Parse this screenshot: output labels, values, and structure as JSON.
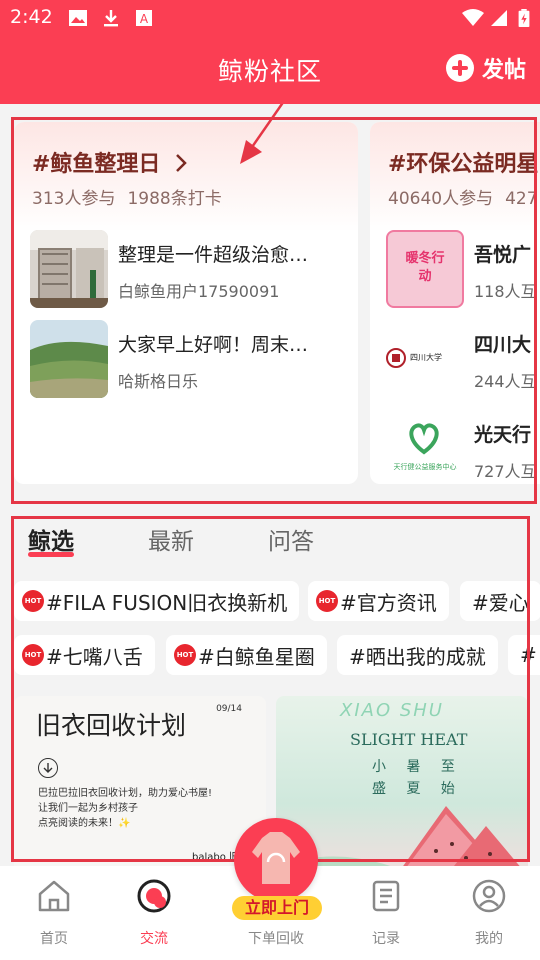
{
  "status_bar": {
    "time": "2:42"
  },
  "header": {
    "title": "鲸粉社区",
    "post_label": "发帖"
  },
  "topics": [
    {
      "title": "#鲸鱼整理日",
      "participants": "313人参与",
      "checkins": "1988条打卡",
      "items": [
        {
          "title": "整理是一件超级治愈…",
          "user": "白鲸鱼用户17590091"
        },
        {
          "title": "大家早上好啊！周末…",
          "user": "哈斯格日乐"
        }
      ]
    },
    {
      "title": "#环保公益明星",
      "participants": "40640人参与",
      "checkins": "427",
      "items": [
        {
          "title": "吾悦广",
          "meta": "118人互",
          "thumb_text": "暖冬行动"
        },
        {
          "title": "四川大",
          "meta": "244人互",
          "thumb_text": "四川大学"
        },
        {
          "title": "光天行",
          "meta": "727人互",
          "thumb_text": "天行健公益服务中心"
        }
      ]
    }
  ],
  "tabs": [
    "鲸选",
    "最新",
    "问答"
  ],
  "chips_row1": [
    {
      "label": "#FILA FUSION旧衣换新机",
      "hot": true
    },
    {
      "label": "#官方资讯",
      "hot": true
    },
    {
      "label": "#爱心",
      "hot": false
    }
  ],
  "chips_row2": [
    {
      "label": "#七嘴八舌",
      "hot": true
    },
    {
      "label": "#白鲸鱼星圈",
      "hot": true
    },
    {
      "label": "#晒出我的成就",
      "hot": false
    },
    {
      "label": "#",
      "hot": false
    }
  ],
  "hot_badge": "HOT",
  "feed": [
    {
      "title": "旧衣回收计划",
      "date": "09/14",
      "desc_line1": "巴拉巴拉旧衣回收计划，助力爱心书屋!",
      "desc_line2": "让我们一起为乡村孩子",
      "desc_line3": "点亮阅读的未来！✨",
      "brand": "balabo 旧衣回收计"
    },
    {
      "title_en": "XIAO SHU",
      "subtitle_en": "SLIGHT HEAT",
      "line1": "小 暑 至",
      "line2": "盛 夏 始"
    }
  ],
  "bottom_nav": [
    {
      "label": "首页",
      "icon": "home-icon"
    },
    {
      "label": "交流",
      "icon": "community-icon"
    },
    {
      "label": "下单回收",
      "icon": "order-icon"
    },
    {
      "label": "记录",
      "icon": "record-icon"
    },
    {
      "label": "我的",
      "icon": "profile-icon"
    }
  ],
  "fab_badge": "立即上门",
  "colors": {
    "brand": "#fb3e53",
    "annotation": "#e53645",
    "badge": "#ffcf33"
  }
}
